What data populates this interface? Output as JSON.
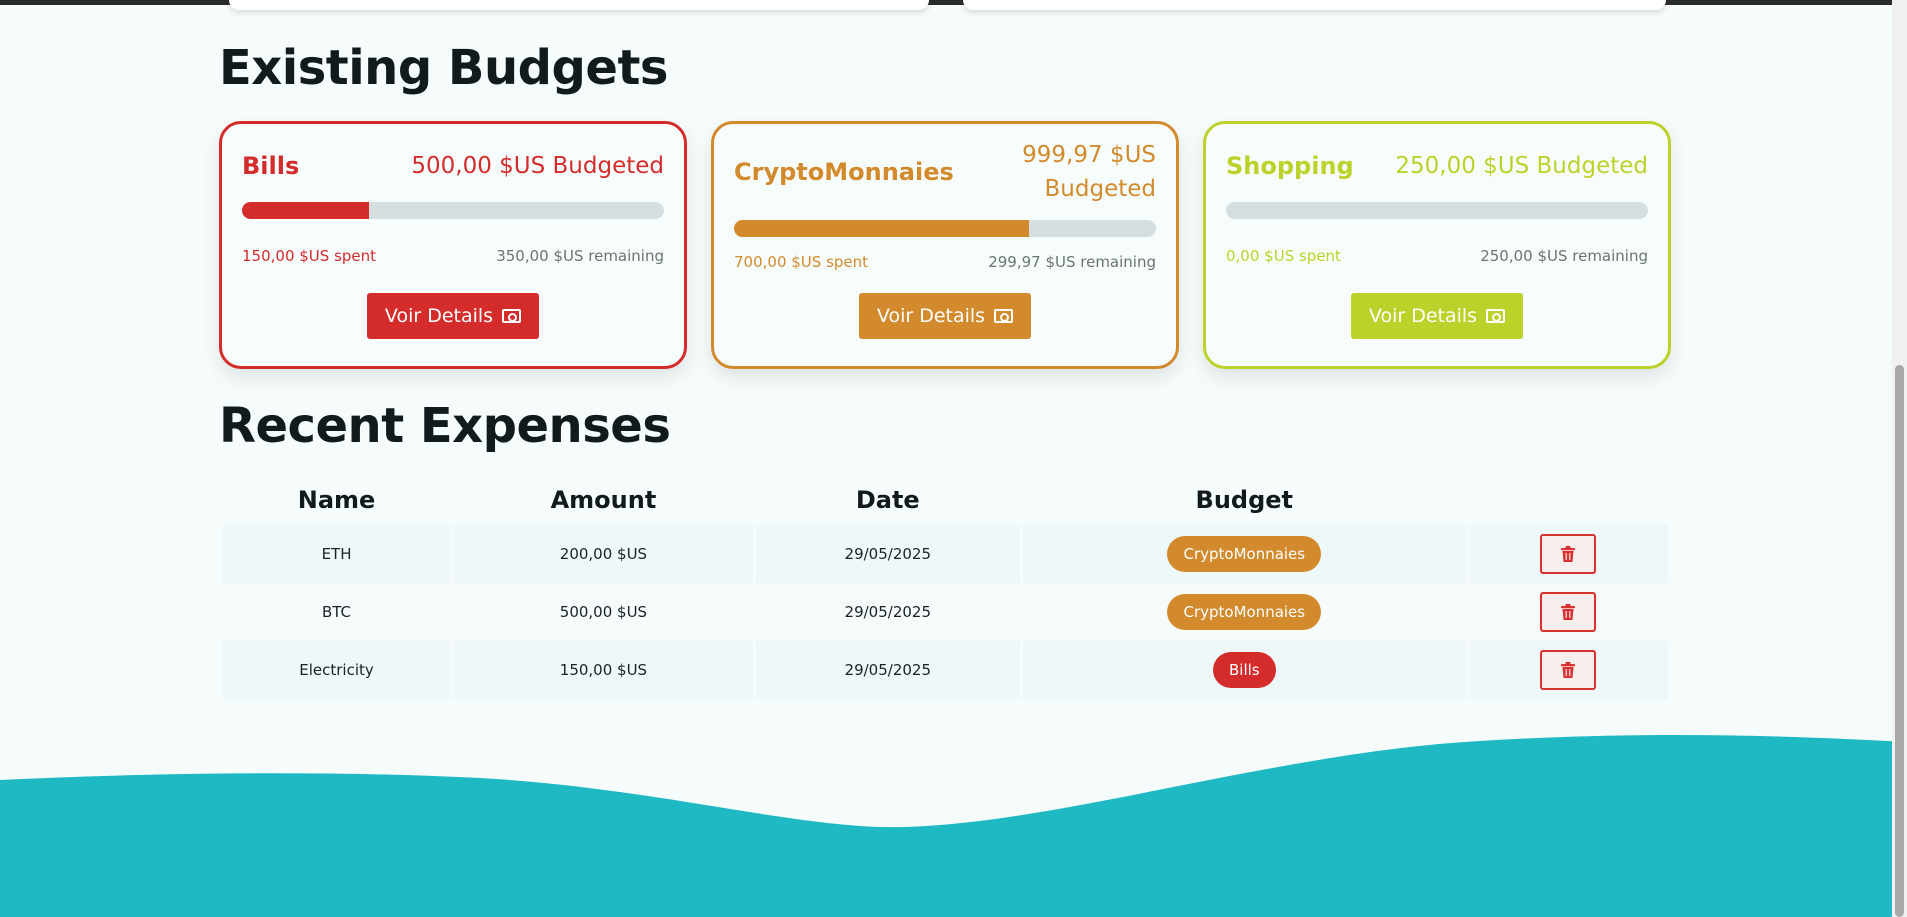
{
  "sections": {
    "budgets_title": "Existing Budgets",
    "expenses_title": "Recent Expenses"
  },
  "budgets": [
    {
      "name": "Bills",
      "amount_label": "500,00 $US Budgeted",
      "spent_label": "150,00 $US spent",
      "remaining_label": "350,00 $US remaining",
      "progress": 0.3,
      "color": "#d42b2b",
      "button_label": "Voir Details"
    },
    {
      "name": "CryptoMonnaies",
      "amount_label": "999,97 $US Budgeted",
      "spent_label": "700,00 $US spent",
      "remaining_label": "299,97 $US remaining",
      "progress": 0.7,
      "color": "#d38a2d",
      "button_label": "Voir Details"
    },
    {
      "name": "Shopping",
      "amount_label": "250,00 $US Budgeted",
      "spent_label": "0,00 $US spent",
      "remaining_label": "250,00 $US remaining",
      "progress": 0.0,
      "color": "#bcd22b",
      "button_label": "Voir Details"
    }
  ],
  "expenses": {
    "headers": [
      "Name",
      "Amount",
      "Date",
      "Budget"
    ],
    "rows": [
      {
        "name": "ETH",
        "amount": "200,00 $US",
        "date": "29/05/2025",
        "budget": "CryptoMonnaies",
        "budget_color": "#d38a2d"
      },
      {
        "name": "BTC",
        "amount": "500,00 $US",
        "date": "29/05/2025",
        "budget": "CryptoMonnaies",
        "budget_color": "#d38a2d"
      },
      {
        "name": "Electricity",
        "amount": "150,00 $US",
        "date": "29/05/2025",
        "budget": "Bills",
        "budget_color": "#d42b2b"
      }
    ]
  },
  "icons": {
    "details": "cash-icon",
    "delete": "trash-icon"
  },
  "colors": {
    "background": "#f6fcfc",
    "wave": "#1fb9c4",
    "delete": "#d9312f"
  }
}
